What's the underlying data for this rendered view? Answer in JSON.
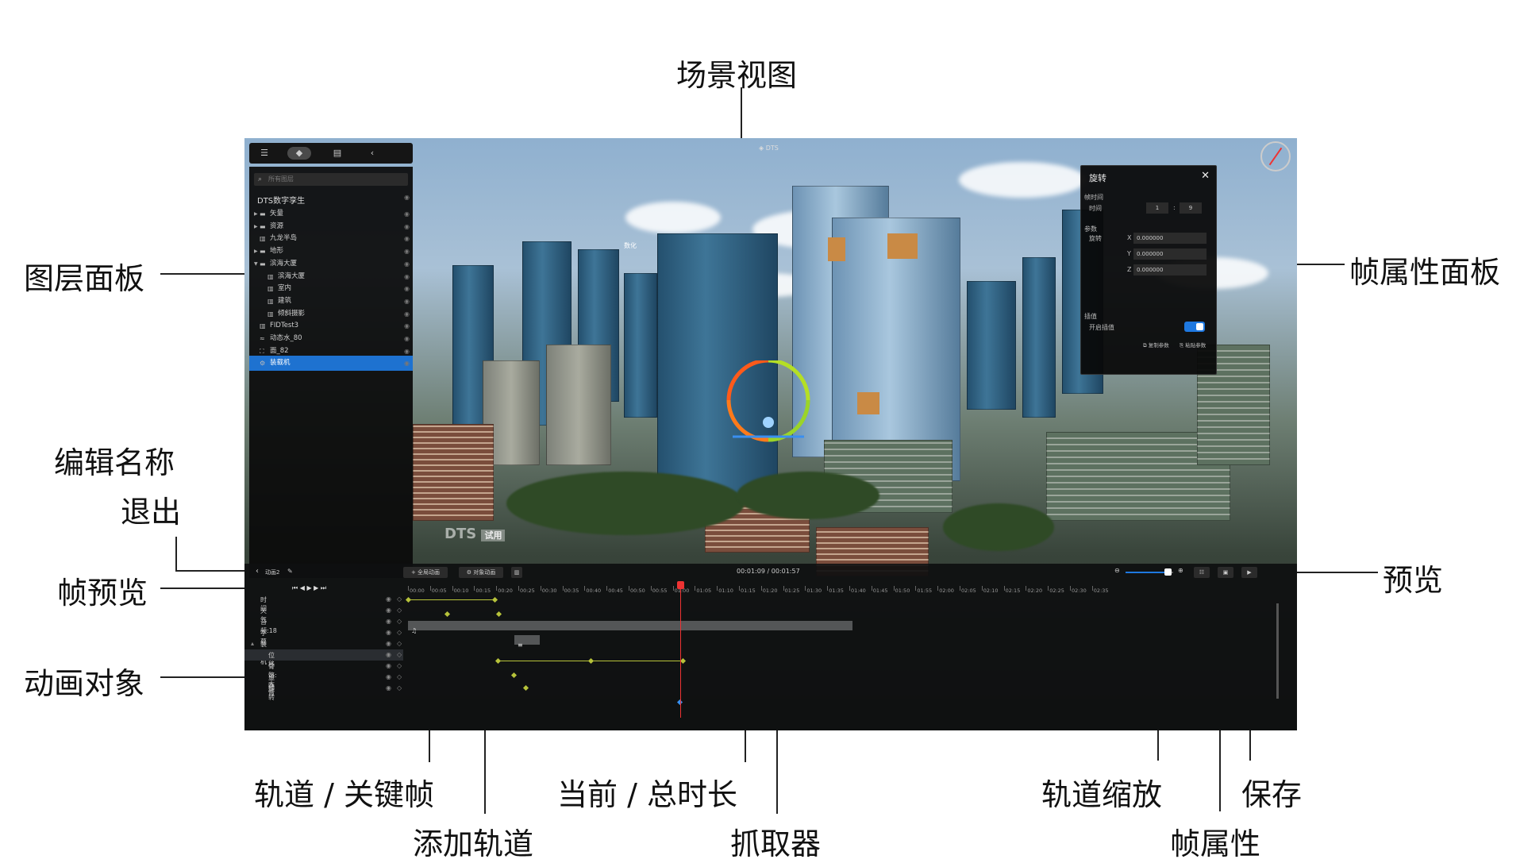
{
  "annotations": {
    "scene_view": "场景视图",
    "layer_panel": "图层面板",
    "frame_property_panel": "帧属性面板",
    "edit_name": "编辑名称",
    "exit": "退出",
    "frame_preview": "帧预览",
    "preview": "预览",
    "animation_object": "动画对象",
    "track_keyframe": "轨道 / 关键帧",
    "add_track": "添加轨道",
    "current_total": "当前 / 总时长",
    "grabber": "抓取器",
    "track_zoom": "轨道缩放",
    "save": "保存",
    "frame_property": "帧属性"
  },
  "scene": {
    "logo_top": "DTS",
    "watermark": "DTS",
    "watermark_badge": "试用",
    "sign_text": "数化"
  },
  "layer_panel": {
    "search_placeholder": "所有图层",
    "root_label": "DTS数字孪生",
    "items": [
      {
        "label": "矢量",
        "icon": "folder",
        "indent": 0,
        "expanded": false
      },
      {
        "label": "资源",
        "icon": "folder",
        "indent": 0,
        "expanded": false
      },
      {
        "label": "九龙半岛",
        "icon": "building",
        "indent": 0
      },
      {
        "label": "地形",
        "icon": "folder",
        "indent": 0,
        "expanded": false
      },
      {
        "label": "滨海大厦",
        "icon": "folder",
        "indent": 0,
        "expanded": true
      },
      {
        "label": "滨海大厦",
        "icon": "building",
        "indent": 1
      },
      {
        "label": "室内",
        "icon": "building",
        "indent": 1
      },
      {
        "label": "建筑",
        "icon": "building",
        "indent": 1
      },
      {
        "label": "倾斜摄影",
        "icon": "building",
        "indent": 1
      },
      {
        "label": "FIDTest3",
        "icon": "building",
        "indent": 0
      },
      {
        "label": "动态水_80",
        "icon": "water",
        "indent": 0
      },
      {
        "label": "面_82",
        "icon": "polygon",
        "indent": 0
      },
      {
        "label": "装载机",
        "icon": "model",
        "indent": 0,
        "selected": true
      }
    ]
  },
  "rotation_panel": {
    "title": "旋转",
    "frame_time_label": "帧时间",
    "time_label": "时间",
    "time_min": "1",
    "time_sep": ":",
    "time_sec": "9",
    "params_label": "参数",
    "rotation_label": "旋转",
    "x_label": "X",
    "x_value": "0.000000",
    "y_label": "Y",
    "y_value": "0.000000",
    "z_label": "Z",
    "z_value": "0.000000",
    "interp_label": "插值",
    "enable_interp_label": "开启插值",
    "interp_enabled": true,
    "copy_params": "复制参数",
    "paste_params": "粘贴参数"
  },
  "timeline": {
    "anim_name": "动画2",
    "add_track_button": "全局动画",
    "object_anim_button": "对象动画",
    "current_time": "00:01:09",
    "time_sep": "/",
    "total_time": "00:01:57",
    "zoom_level": 0.88,
    "ticks": [
      "00:00",
      "00:05",
      "00:10",
      "00:15",
      "00:20",
      "00:25",
      "00:30",
      "00:35",
      "00:40",
      "00:45",
      "00:50",
      "00:55",
      "01:00",
      "01:05",
      "01:10",
      "01:15",
      "01:20",
      "01:25",
      "01:30",
      "01:35",
      "01:40",
      "01:45",
      "01:50",
      "01:55",
      "02:00",
      "02:05",
      "02:10",
      "02:15",
      "02:20",
      "02:25",
      "02:30",
      "02:35"
    ],
    "tracks": [
      {
        "name": "时间",
        "indent": 0
      },
      {
        "name": "天气",
        "indent": 0
      },
      {
        "name": "音频:18",
        "indent": 0
      },
      {
        "name": "字幕",
        "indent": 0
      },
      {
        "name": "装载机",
        "indent": 0,
        "group": true
      },
      {
        "name": "位移",
        "indent": 1,
        "selected": true
      },
      {
        "name": "骨骼:大臂",
        "indent": 1
      },
      {
        "name": "显隐",
        "indent": 1
      },
      {
        "name": "旋转",
        "indent": 1
      }
    ]
  }
}
